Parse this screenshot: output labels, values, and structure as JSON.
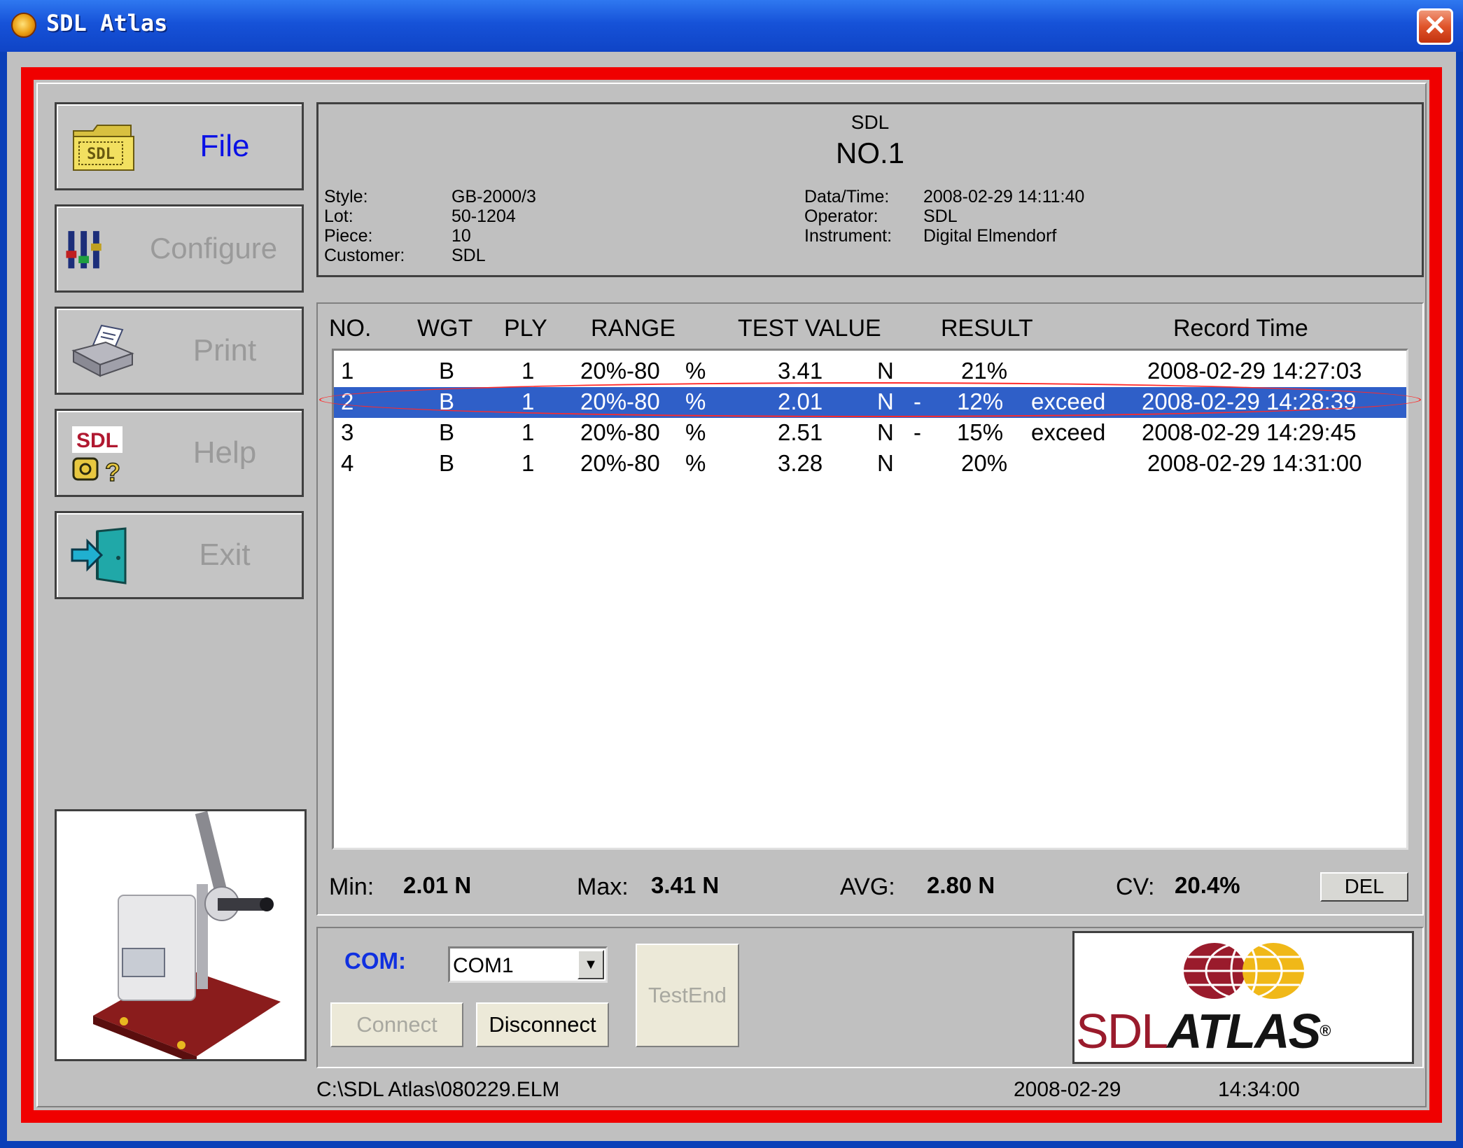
{
  "window": {
    "title": "SDL Atlas",
    "close_symbol": "✕"
  },
  "sidebar": {
    "items": [
      {
        "label": "File",
        "icon": "folder-icon"
      },
      {
        "label": "Configure",
        "icon": "sliders-icon"
      },
      {
        "label": "Print",
        "icon": "printer-icon"
      },
      {
        "label": "Help",
        "icon": "help-icon"
      },
      {
        "label": "Exit",
        "icon": "exit-door-icon"
      }
    ],
    "folder_text": "SDL",
    "help_logo_text": "SDL"
  },
  "header": {
    "title": "SDL",
    "number": "NO.1",
    "left_labels": [
      "Style:",
      "Lot:",
      "Piece:",
      "Customer:"
    ],
    "left_values": [
      "GB-2000/3",
      "50-1204",
      "10",
      "SDL"
    ],
    "right_labels": [
      "Data/Time:",
      "Operator:",
      "Instrument:"
    ],
    "right_values": [
      "2008-02-29 14:11:40",
      "SDL",
      "Digital Elmendorf"
    ]
  },
  "table": {
    "columns": [
      "NO.",
      "WGT",
      "PLY",
      "RANGE",
      "TEST VALUE",
      "RESULT",
      "Record Time"
    ],
    "selected_row": 2,
    "rows": [
      {
        "no": "1",
        "wgt": "B",
        "ply": "1",
        "range": "20%-80",
        "range_unit": "%",
        "value": "3.41",
        "unit": "N",
        "sign": "",
        "result": "21%",
        "flag": "",
        "time": "2008-02-29 14:27:03"
      },
      {
        "no": "2",
        "wgt": "B",
        "ply": "1",
        "range": "20%-80",
        "range_unit": "%",
        "value": "2.01",
        "unit": "N",
        "sign": "-",
        "result": "12%",
        "flag": "exceed",
        "time": "2008-02-29 14:28:39"
      },
      {
        "no": "3",
        "wgt": "B",
        "ply": "1",
        "range": "20%-80",
        "range_unit": "%",
        "value": "2.51",
        "unit": "N",
        "sign": "-",
        "result": "15%",
        "flag": "exceed",
        "time": "2008-02-29 14:29:45"
      },
      {
        "no": "4",
        "wgt": "B",
        "ply": "1",
        "range": "20%-80",
        "range_unit": "%",
        "value": "3.28",
        "unit": "N",
        "sign": "",
        "result": "20%",
        "flag": "",
        "time": "2008-02-29 14:31:00"
      }
    ]
  },
  "stats": {
    "min_label": "Min:",
    "min": "2.01 N",
    "max_label": "Max:",
    "max": "3.41 N",
    "avg_label": "AVG:",
    "avg": "2.80 N",
    "cv_label": "CV:",
    "cv": "20.4%",
    "del_label": "DEL"
  },
  "com": {
    "label": "COM:",
    "selected": "COM1",
    "connect_label": "Connect",
    "disconnect_label": "Disconnect",
    "testend_label": "TestEnd"
  },
  "logo": {
    "left": "SDL",
    "right": "ATLAS",
    "mark": "®"
  },
  "status": {
    "path": "C:\\SDL Atlas\\080229.ELM",
    "date": "2008-02-29",
    "time": "14:34:00"
  },
  "colors": {
    "frame": "#f00000",
    "selection": "#2f5fc8",
    "accent_blue": "#1030e0",
    "logo_red": "#9a1b2c",
    "logo_black": "#141414"
  }
}
